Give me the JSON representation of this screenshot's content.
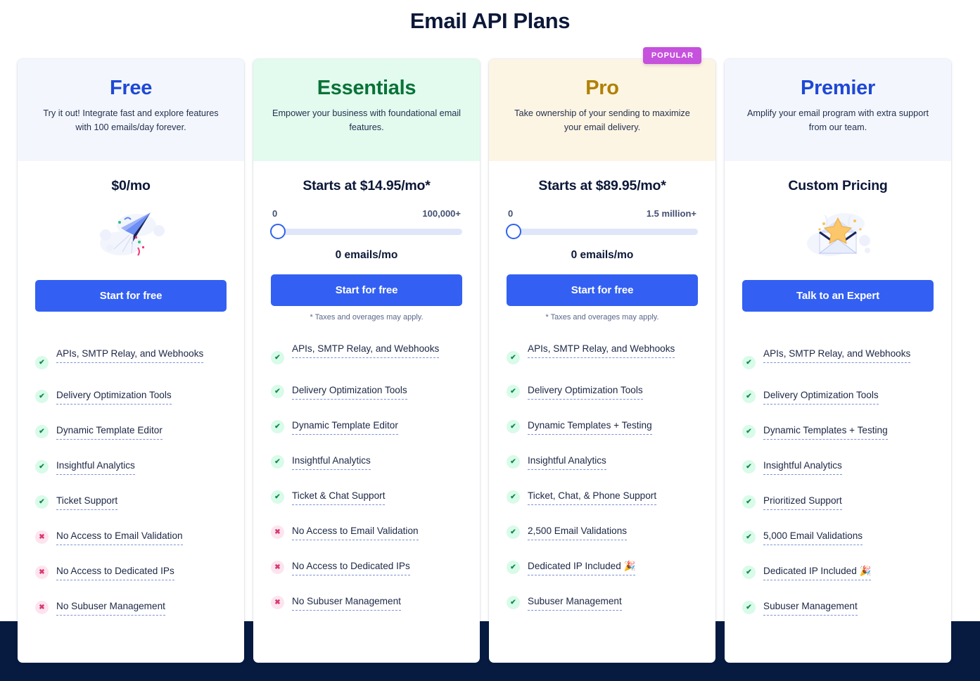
{
  "page": {
    "title": "Email API Plans",
    "accent_blue": "#3360f2",
    "badge_color": "#c551dc",
    "footer_band_color": "#071a40",
    "yes_color": "#0f8a4c",
    "no_color": "#d8386f"
  },
  "plans": [
    {
      "name": "Free",
      "name_color": "#1f48d6",
      "header_bg": "#f3f7fd",
      "description": "Try it out! Integrate fast and explore features with 100 emails/day forever.",
      "price": "$0/mo",
      "has_slider": false,
      "illustration": "paper-plane-cloud-illustration",
      "cta_label": "Start for free",
      "taxes_note": "",
      "badge": "",
      "features": [
        {
          "label": "APIs, SMTP Relay, and Webhooks",
          "included": true
        },
        {
          "label": "Delivery Optimization Tools",
          "included": true
        },
        {
          "label": "Dynamic Template Editor",
          "included": true
        },
        {
          "label": "Insightful Analytics",
          "included": true
        },
        {
          "label": "Ticket Support",
          "included": true
        },
        {
          "label": "No Access to Email Validation",
          "included": false
        },
        {
          "label": "No Access to Dedicated IPs",
          "included": false
        },
        {
          "label": "No Subuser Management",
          "included": false
        }
      ]
    },
    {
      "name": "Essentials",
      "name_color": "#087337",
      "header_bg": "#e2fbee",
      "description": "Empower your business with foundational email features.",
      "price": "Starts at $14.95/mo*",
      "has_slider": true,
      "slider": {
        "min_label": "0",
        "max_label": "100,000+",
        "value_label": "0 emails/mo",
        "position_percent": 0
      },
      "illustration": "",
      "cta_label": "Start for free",
      "taxes_note": "* Taxes and overages may apply.",
      "badge": "",
      "features": [
        {
          "label": "APIs, SMTP Relay, and Webhooks",
          "included": true
        },
        {
          "label": "Delivery Optimization Tools",
          "included": true
        },
        {
          "label": "Dynamic Template Editor",
          "included": true
        },
        {
          "label": "Insightful Analytics",
          "included": true
        },
        {
          "label": "Ticket & Chat Support",
          "included": true
        },
        {
          "label": "No Access to Email Validation",
          "included": false
        },
        {
          "label": "No Access to Dedicated IPs",
          "included": false
        },
        {
          "label": "No Subuser Management",
          "included": false
        }
      ]
    },
    {
      "name": "Pro",
      "name_color": "#b08006",
      "header_bg": "#fdf5e3",
      "description": "Take ownership of your sending to maximize your email delivery.",
      "price": "Starts at $89.95/mo*",
      "has_slider": true,
      "slider": {
        "min_label": "0",
        "max_label": "1.5 million+",
        "value_label": "0 emails/mo",
        "position_percent": 0
      },
      "illustration": "",
      "cta_label": "Start for free",
      "taxes_note": "* Taxes and overages may apply.",
      "badge": "POPULAR",
      "features": [
        {
          "label": "APIs, SMTP Relay, and Webhooks",
          "included": true
        },
        {
          "label": "Delivery Optimization Tools",
          "included": true
        },
        {
          "label": "Dynamic Templates + Testing",
          "included": true
        },
        {
          "label": "Insightful Analytics",
          "included": true
        },
        {
          "label": "Ticket, Chat, & Phone Support",
          "included": true
        },
        {
          "label": "2,500 Email Validations",
          "included": true
        },
        {
          "label": "Dedicated IP Included 🎉",
          "included": true
        },
        {
          "label": "Subuser Management",
          "included": true
        }
      ]
    },
    {
      "name": "Premier",
      "name_color": "#1f48d6",
      "header_bg": "#f3f7fd",
      "description": "Amplify your email program with extra support from our team.",
      "price": "Custom Pricing",
      "has_slider": false,
      "illustration": "envelope-star-illustration",
      "cta_label": "Talk to an Expert",
      "taxes_note": "",
      "badge": "",
      "features": [
        {
          "label": "APIs, SMTP Relay, and Webhooks",
          "included": true
        },
        {
          "label": "Delivery Optimization Tools",
          "included": true
        },
        {
          "label": "Dynamic Templates + Testing",
          "included": true
        },
        {
          "label": "Insightful Analytics",
          "included": true
        },
        {
          "label": "Prioritized Support",
          "included": true
        },
        {
          "label": "5,000 Email Validations",
          "included": true
        },
        {
          "label": "Dedicated IP Included 🎉",
          "included": true
        },
        {
          "label": "Subuser Management",
          "included": true
        }
      ]
    }
  ]
}
